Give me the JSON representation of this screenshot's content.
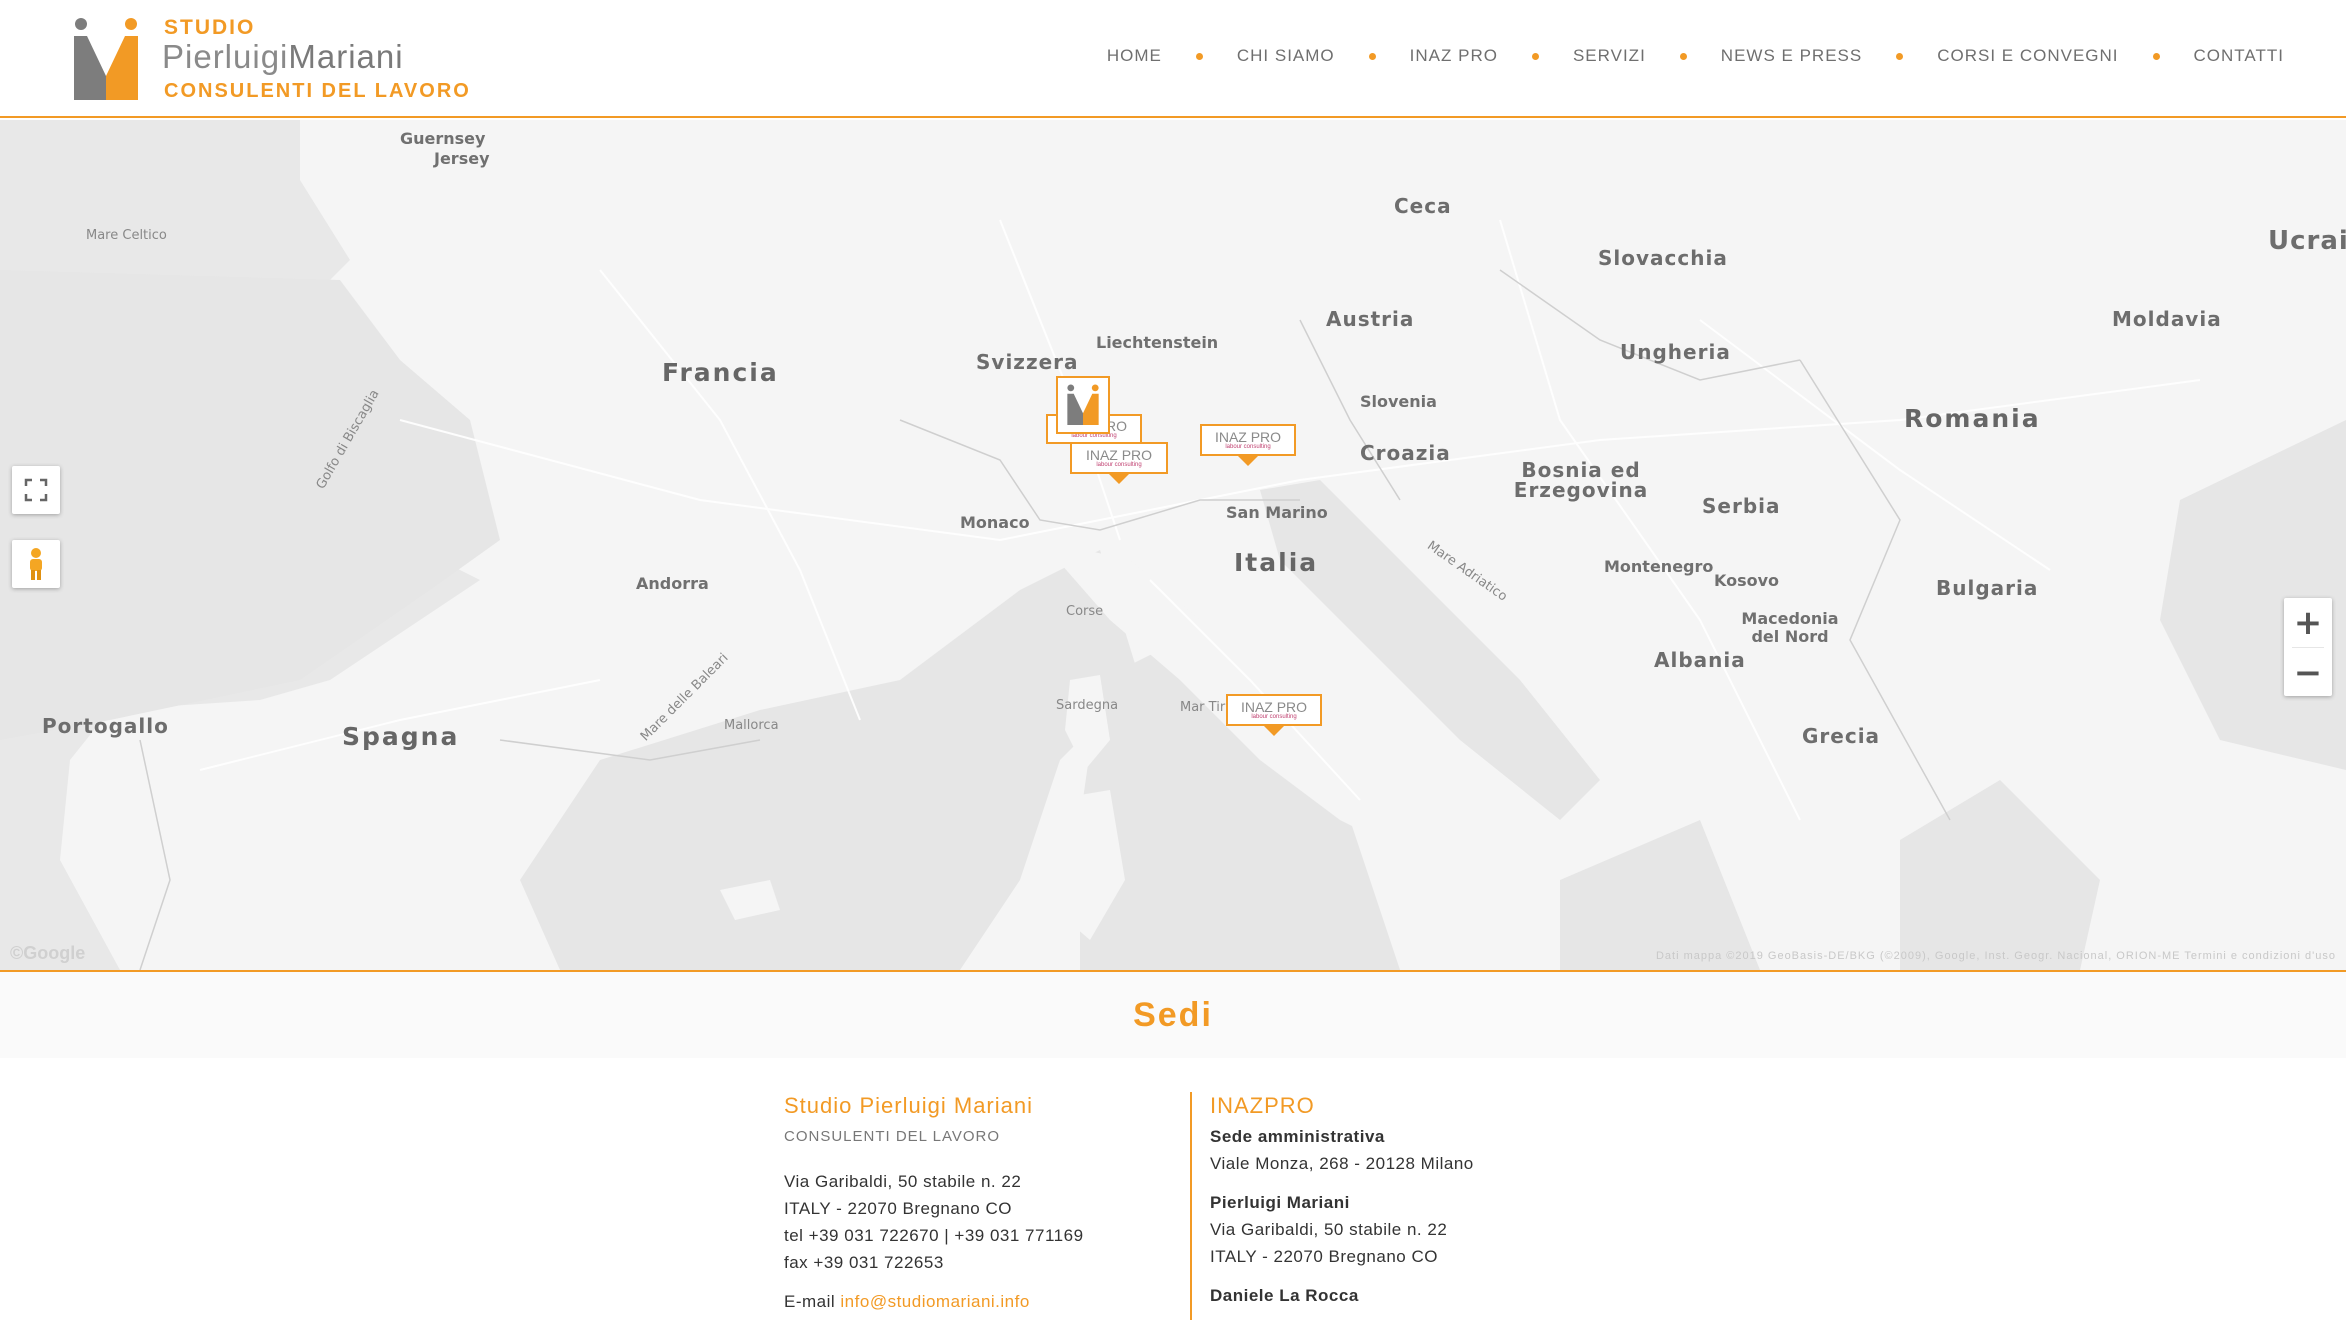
{
  "header": {
    "logo": {
      "studio": "STUDIO",
      "name_first": "Pierluigi",
      "name_last": "Mariani",
      "subtitle": "CONSULENTI DEL LAVORO"
    },
    "nav": [
      "HOME",
      "CHI SIAMO",
      "INAZ PRO",
      "SERVIZI",
      "NEWS E PRESS",
      "CORSI E CONVEGNI",
      "CONTATTI"
    ]
  },
  "colors": {
    "accent": "#f29a25",
    "text": "#333333",
    "map_land": "#f4f4f4",
    "map_water": "#e6e6e6"
  },
  "map": {
    "labels": {
      "countries": [
        "Francia",
        "Italia",
        "Spagna",
        "Romania",
        "Austria",
        "Slovacchia",
        "Ungheria",
        "Croazia",
        "Serbia",
        "Bulgaria",
        "Albania",
        "Grecia",
        "Svizzera",
        "Moldavia",
        "Bosnia ed Erzegovina",
        "Slovenia",
        "Portogallo",
        "Ucrai",
        "Ceca"
      ],
      "small": [
        "Guernsey",
        "Jersey",
        "Liechtenstein",
        "Monaco",
        "San Marino",
        "Andorra",
        "Montenegro",
        "Kosovo",
        "Macedonia del Nord",
        "Corse",
        "Sardegna",
        "Mallorca"
      ],
      "seas": [
        "Mare Celtico",
        "Golfo di Biscaglia",
        "Mare delle Baleari",
        "Mar Tirreno",
        "Mare Adriatico"
      ]
    },
    "markers": [
      {
        "label": "INAZ PRO",
        "sub": "labour consulting",
        "icon": "studio-mariani-logo-marker"
      },
      {
        "label": "INAZ PRO",
        "sub": "labour consulting"
      },
      {
        "label": "INAZ PRO",
        "sub": "labour consulting"
      },
      {
        "label": "INAZ PRO",
        "sub": "labour consulting"
      }
    ],
    "controls": {
      "fullscreen_icon": "fullscreen-icon",
      "pegman_icon": "pegman-icon",
      "zoom_in": "+",
      "zoom_out": "−"
    },
    "google": "©Google",
    "attribution": "Dati mappa ©2019 GeoBasis-DE/BKG (©2009), Google, Inst. Geogr. Nacional, ORION-ME   Termini e condizioni d'uso"
  },
  "section": {
    "title": "Sedi"
  },
  "offices": {
    "left": {
      "title": "Studio Pierluigi Mariani",
      "subtitle": "CONSULENTI DEL LAVORO",
      "address1": "Via Garibaldi, 50 stabile n. 22",
      "address2": "ITALY - 22070 Bregnano CO",
      "tel": "tel +39 031 722670 | +39 031 771169",
      "fax": "fax +39 031 722653",
      "email_label": "E-mail",
      "email": "info@studiomariani.info"
    },
    "right": {
      "title": "INAZPRO",
      "block1_title": "Sede amministrativa",
      "block1_line1": "Viale Monza, 268 - 20128 Milano",
      "block2_title": "Pierluigi Mariani",
      "block2_line1": "Via Garibaldi, 50 stabile n. 22",
      "block2_line2": "ITALY - 22070 Bregnano CO",
      "block3_title": "Daniele La Rocca"
    }
  }
}
